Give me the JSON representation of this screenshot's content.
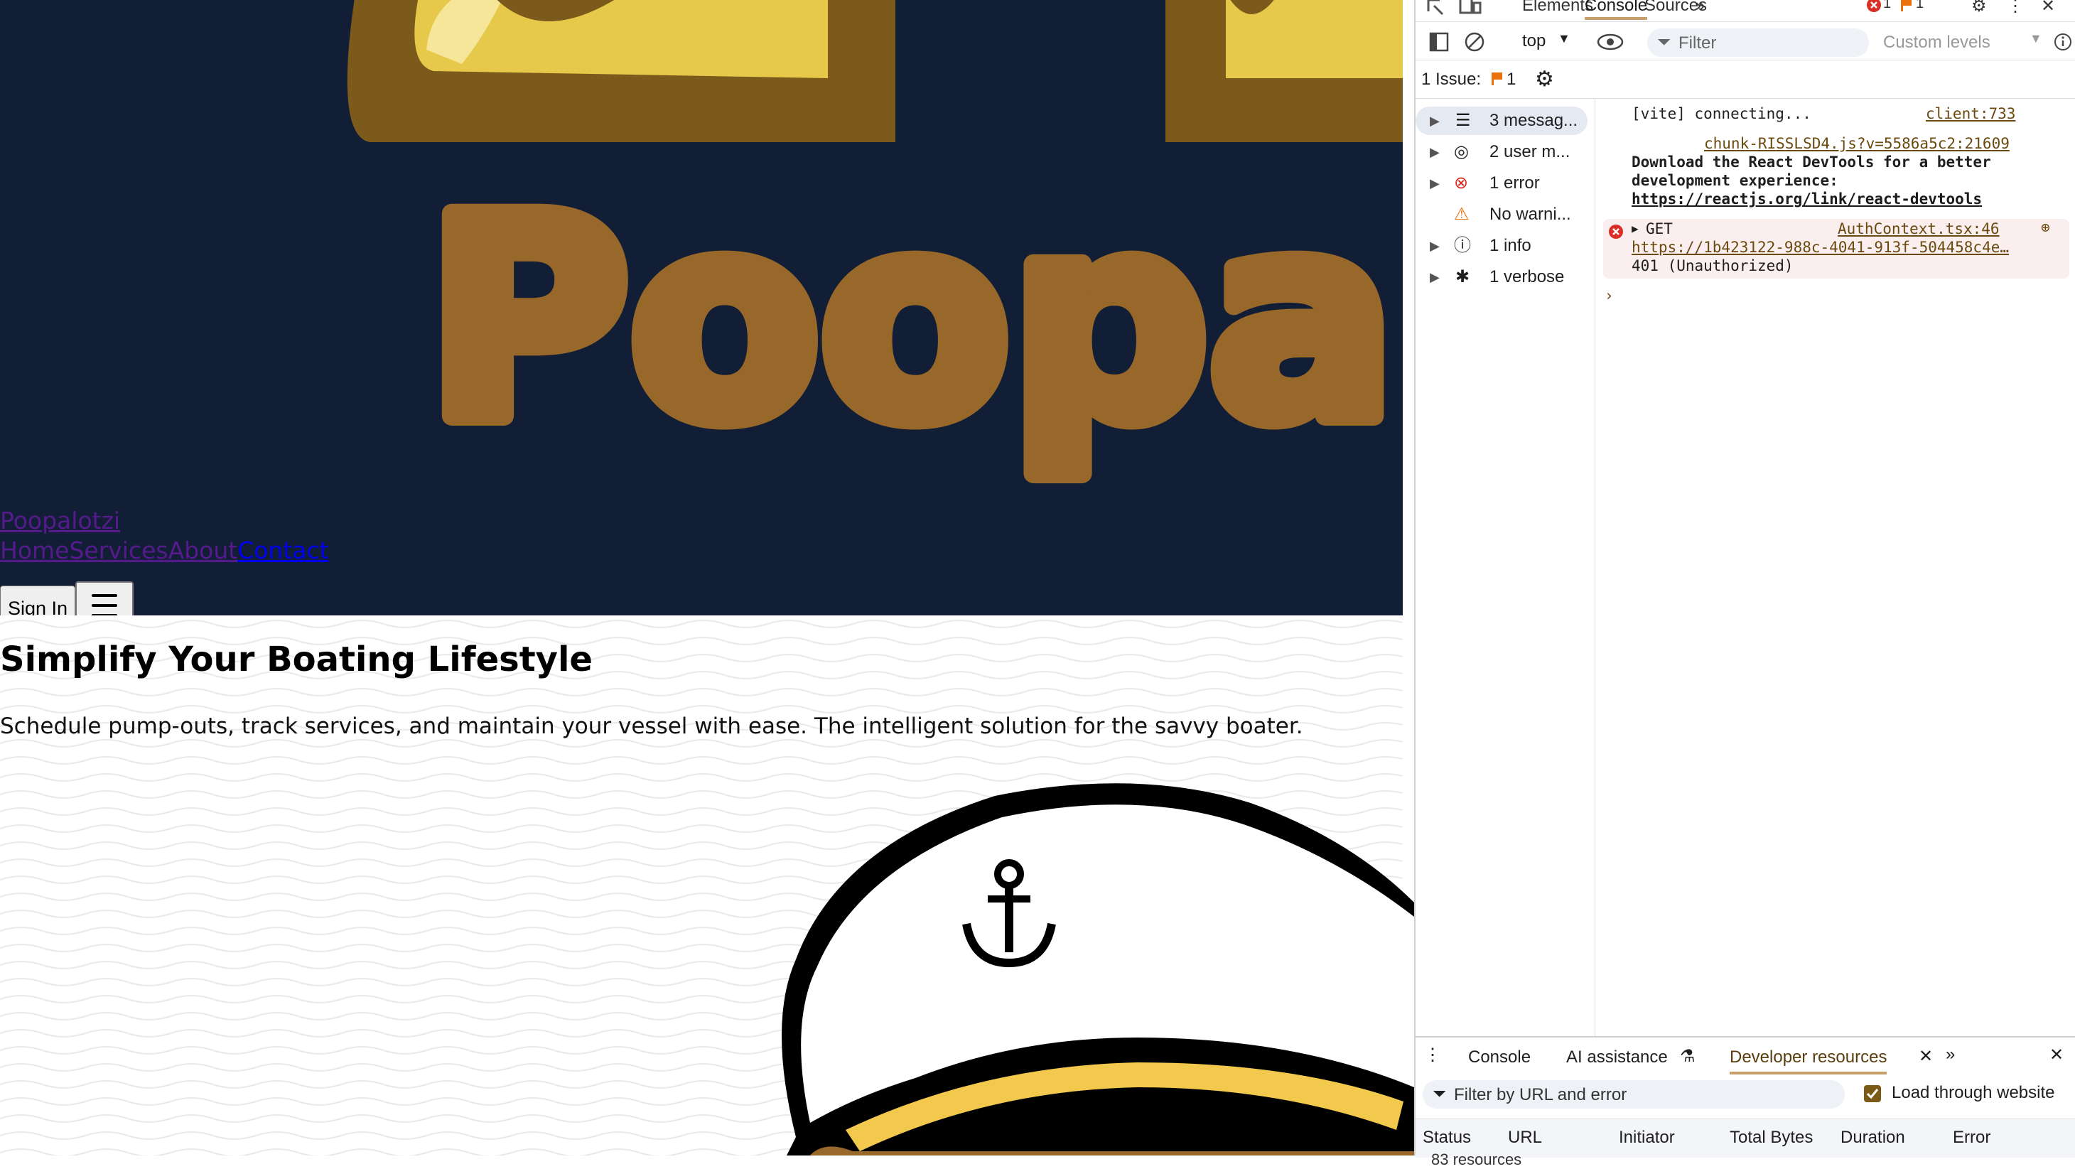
{
  "site": {
    "brand": "Poopalotzi",
    "wordmark_fragment": "Poopalo",
    "nav": [
      "Home",
      "Services",
      "About",
      "Contact"
    ],
    "signin_label": "Sign In",
    "hero": {
      "headline": "Simplify Your Boating Lifestyle",
      "subtext": "Schedule pump-outs, track services, and maintain your vessel with ease. The intelligent solution for the savvy boater."
    },
    "colors": {
      "band": "#121e36",
      "wordmark": "#97682a",
      "cheese": "#e6c84a",
      "outline": "#7b5a1c"
    }
  },
  "devtools": {
    "tabs": [
      "Elements",
      "Console",
      "Sources"
    ],
    "active_tab": "Console",
    "error_badge": "1",
    "issue_badge": "1",
    "context": "top",
    "filter_placeholder": "Filter",
    "levels": "Custom levels",
    "issues_label": "1 Issue:",
    "issues_count": "1",
    "sidebar": [
      {
        "label": "3 messag...",
        "icon": "list-icon"
      },
      {
        "label": "2 user m...",
        "icon": "user-icon"
      },
      {
        "label": "1 error",
        "icon": "error-icon"
      },
      {
        "label": "No warni...",
        "icon": "warning-icon"
      },
      {
        "label": "1 info",
        "icon": "info-icon"
      },
      {
        "label": "1 verbose",
        "icon": "bug-icon"
      }
    ],
    "messages": {
      "vite_text": "[vite] connecting...",
      "vite_src": "client:733",
      "chunk_src": "chunk-RISSLSD4.js?v=5586a5c2:21609",
      "react_line1": "Download the React DevTools for a better",
      "react_line2": "development experience:",
      "react_link": "https://reactjs.org/link/react-devtools",
      "err_method": "GET",
      "err_src": "AuthContext.tsx:46",
      "err_url": "https://1b423122-988c-4041-913f-504458c4e…",
      "err_status": "401 (Unauthorized)"
    },
    "drawer": {
      "tabs": [
        "Console",
        "AI assistance",
        "Developer resources"
      ],
      "active_tab": "Developer resources",
      "filter_placeholder": "Filter by URL and error",
      "load_label": "Load through website",
      "load_checked": true,
      "columns": [
        "Status",
        "URL",
        "Initiator",
        "Total Bytes",
        "Duration",
        "Error"
      ],
      "count": "83 resources"
    }
  }
}
